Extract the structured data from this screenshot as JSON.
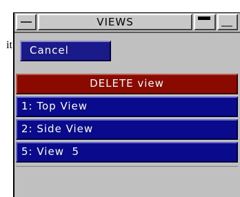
{
  "background_fragment": "it",
  "window": {
    "title": "VIEWS"
  },
  "cancel_label": "Cancel",
  "delete_header": "DELETE view",
  "views": [
    {
      "label": "1: Top View"
    },
    {
      "label": "2: Side View"
    },
    {
      "label": "5: View  5"
    }
  ],
  "colors": {
    "window_bg": "#c0c0c0",
    "button_blue": "#0a0a8c",
    "header_red": "#8b0a00",
    "text_light": "#ffffff"
  },
  "icons": {
    "menu": "window-menu-icon",
    "maximize": "maximize-icon",
    "minimize": "minimize-icon"
  }
}
